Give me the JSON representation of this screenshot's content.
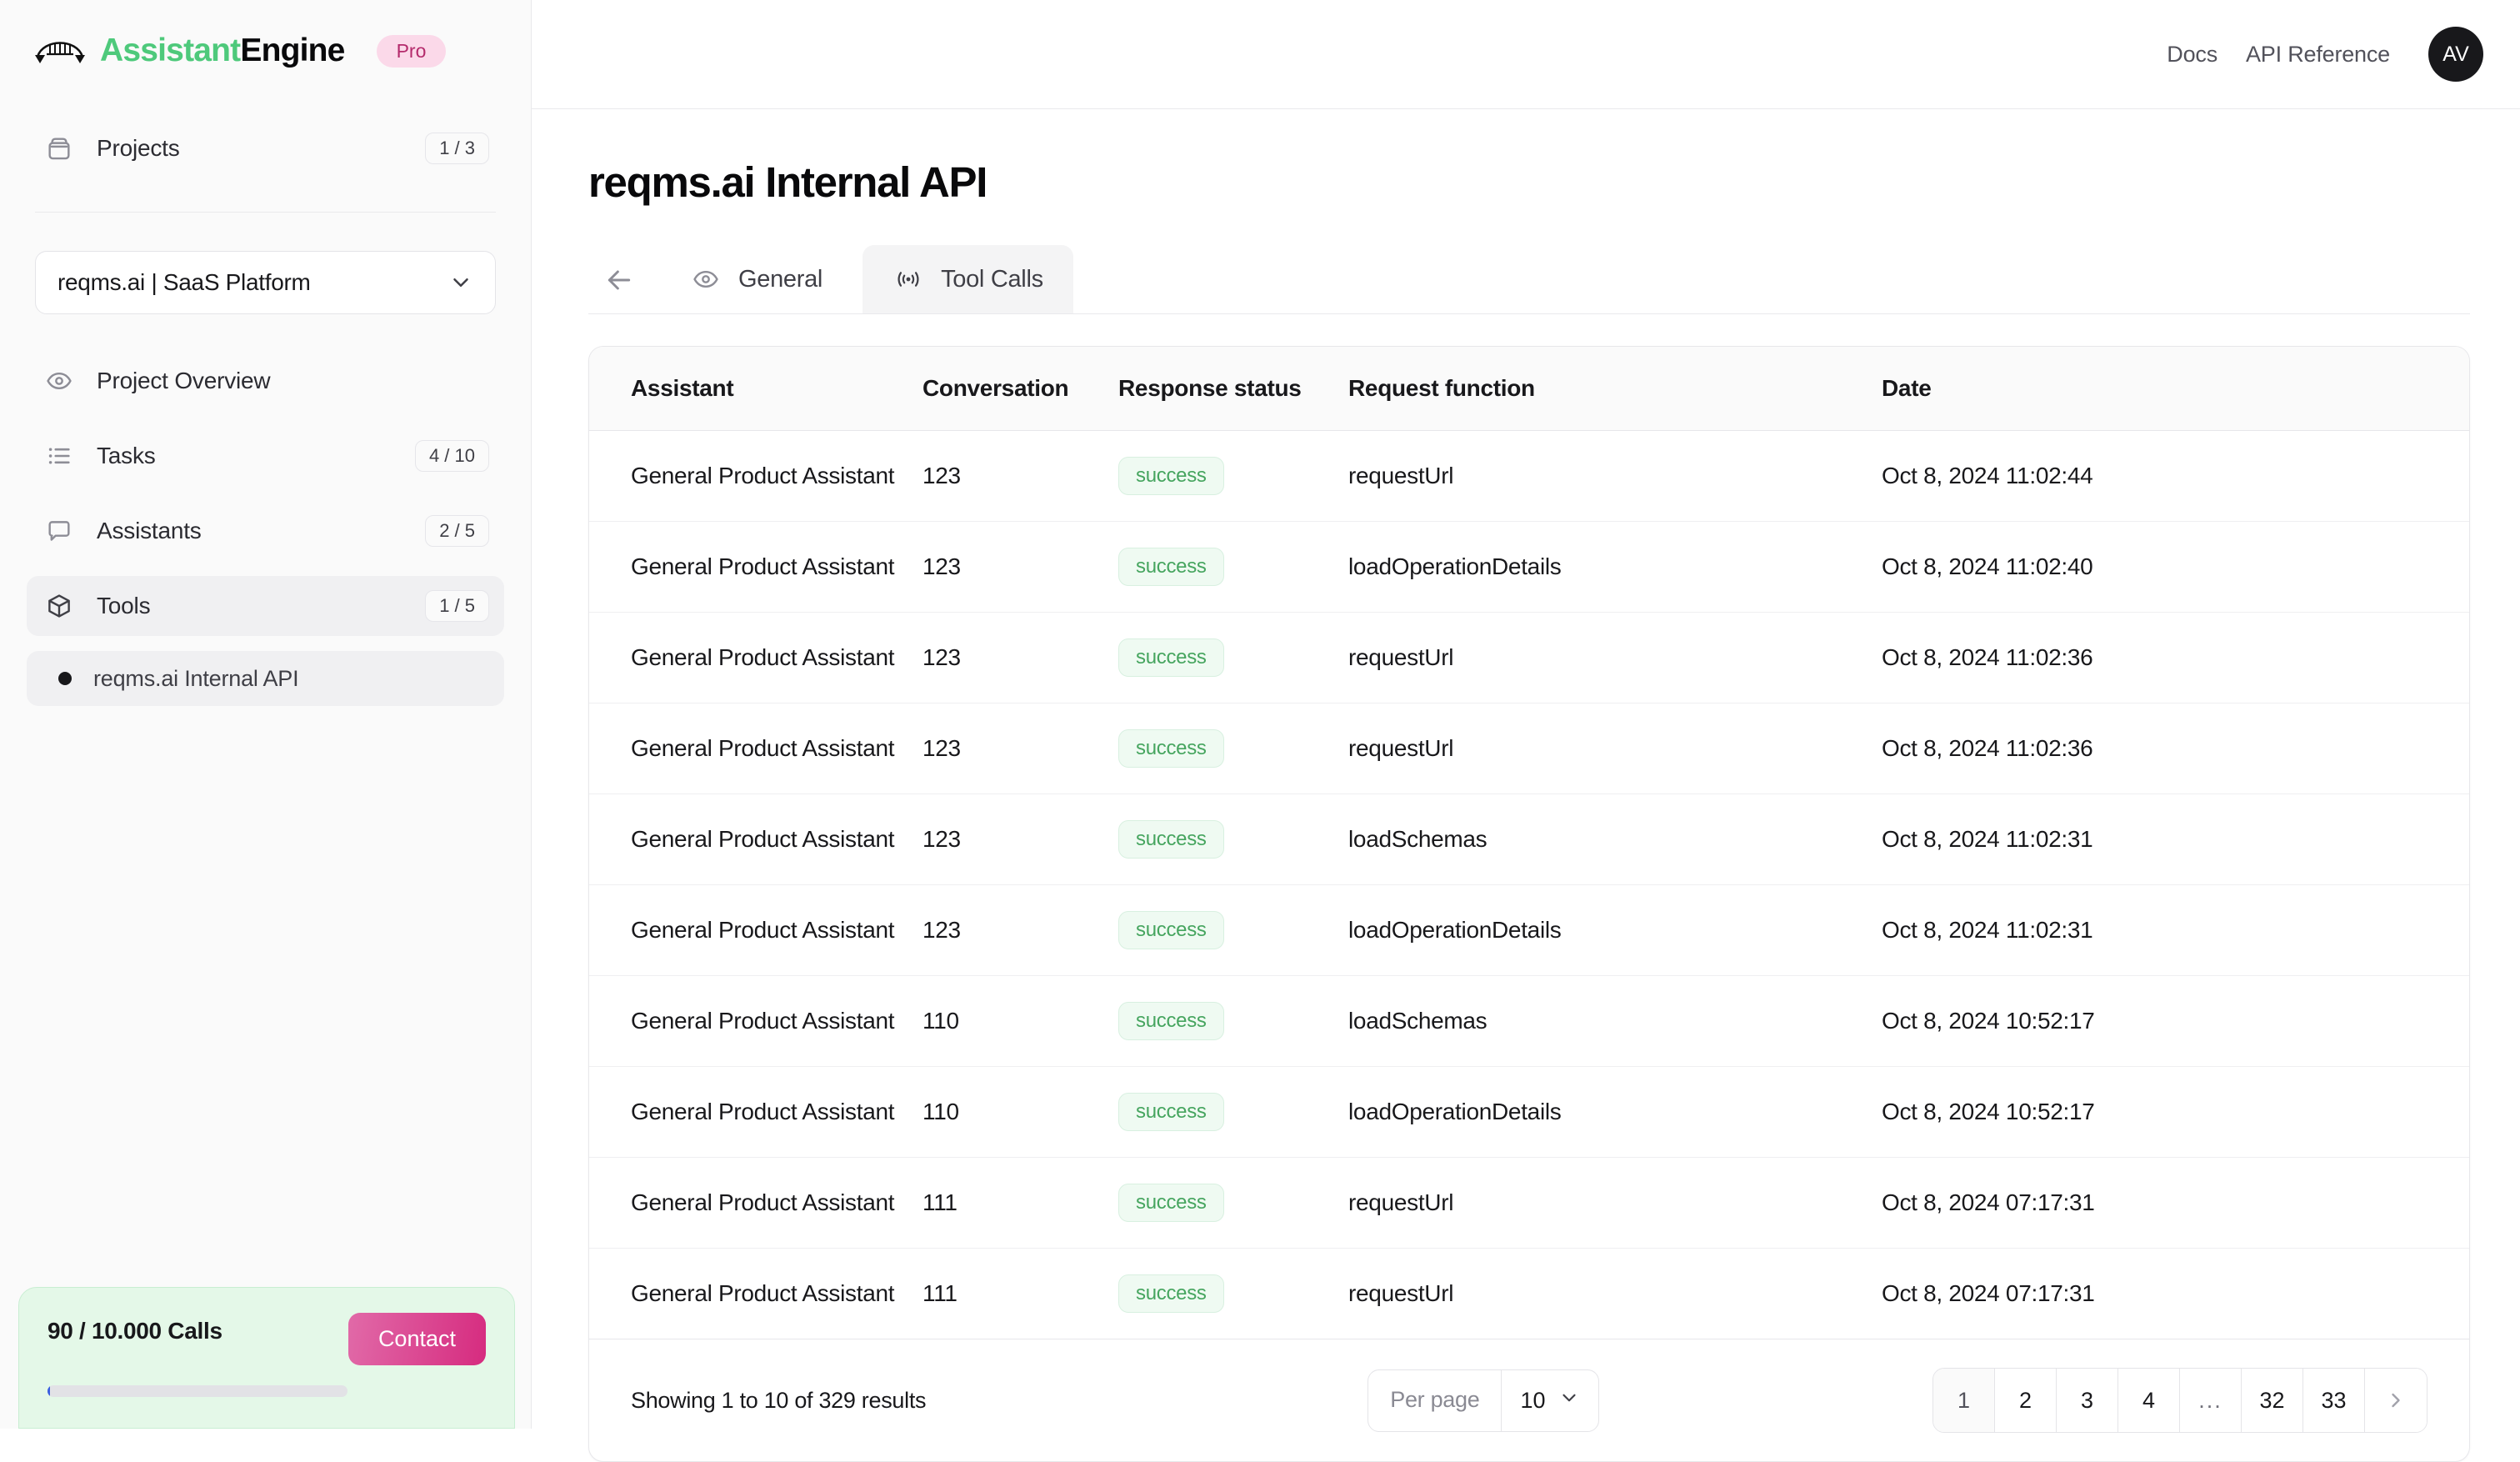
{
  "brand": {
    "name_first": "Assistant",
    "name_second": "Engine",
    "plan_badge": "Pro",
    "logo_icon": "bridge-arch-icon"
  },
  "sidebar": {
    "projects": {
      "label": "Projects",
      "count": "1 / 3",
      "icon": "archive-box-icon"
    },
    "project_selector": {
      "value": "reqms.ai | SaaS Platform",
      "icon": "chevron-down-icon"
    },
    "items": [
      {
        "label": "Project Overview",
        "count": "",
        "icon": "eye-icon"
      },
      {
        "label": "Tasks",
        "count": "4 / 10",
        "icon": "list-icon"
      },
      {
        "label": "Assistants",
        "count": "2 / 5",
        "icon": "chat-bubble-icon"
      },
      {
        "label": "Tools",
        "count": "1 / 5",
        "icon": "cube-icon"
      }
    ],
    "sub_item": {
      "label": "reqms.ai Internal API",
      "icon": "dot-icon"
    },
    "usage": {
      "text": "90 / 10.000 Calls",
      "contact_label": "Contact",
      "progress_percent": 0.9,
      "bar_color": "#3b5fe0",
      "card_bg": "#e4f8e8"
    }
  },
  "topbar": {
    "links": [
      {
        "label": "Docs"
      },
      {
        "label": "API Reference"
      }
    ],
    "avatar_initials": "AV"
  },
  "page": {
    "title": "reqms.ai Internal API",
    "back_icon": "arrow-left-icon",
    "tabs": [
      {
        "label": "General",
        "icon": "eye-icon",
        "active": false
      },
      {
        "label": "Tool Calls",
        "icon": "broadcast-signal-icon",
        "active": true
      }
    ]
  },
  "table": {
    "columns": [
      "Assistant",
      "Conversation",
      "Response status",
      "Request function",
      "Date"
    ],
    "rows": [
      {
        "assistant": "General Product Assistant",
        "conversation": "123",
        "status": "success",
        "function": "requestUrl",
        "date": "Oct 8, 2024 11:02:44"
      },
      {
        "assistant": "General Product Assistant",
        "conversation": "123",
        "status": "success",
        "function": "loadOperationDetails",
        "date": "Oct 8, 2024 11:02:40"
      },
      {
        "assistant": "General Product Assistant",
        "conversation": "123",
        "status": "success",
        "function": "requestUrl",
        "date": "Oct 8, 2024 11:02:36"
      },
      {
        "assistant": "General Product Assistant",
        "conversation": "123",
        "status": "success",
        "function": "requestUrl",
        "date": "Oct 8, 2024 11:02:36"
      },
      {
        "assistant": "General Product Assistant",
        "conversation": "123",
        "status": "success",
        "function": "loadSchemas",
        "date": "Oct 8, 2024 11:02:31"
      },
      {
        "assistant": "General Product Assistant",
        "conversation": "123",
        "status": "success",
        "function": "loadOperationDetails",
        "date": "Oct 8, 2024 11:02:31"
      },
      {
        "assistant": "General Product Assistant",
        "conversation": "110",
        "status": "success",
        "function": "loadSchemas",
        "date": "Oct 8, 2024 10:52:17"
      },
      {
        "assistant": "General Product Assistant",
        "conversation": "110",
        "status": "success",
        "function": "loadOperationDetails",
        "date": "Oct 8, 2024 10:52:17"
      },
      {
        "assistant": "General Product Assistant",
        "conversation": "111",
        "status": "success",
        "function": "requestUrl",
        "date": "Oct 8, 2024 07:17:31"
      },
      {
        "assistant": "General Product Assistant",
        "conversation": "111",
        "status": "success",
        "function": "requestUrl",
        "date": "Oct 8, 2024 07:17:31"
      }
    ],
    "status_colors": {
      "success_bg": "#effaf2",
      "success_text": "#46a55f"
    }
  },
  "pagination": {
    "showing_text": "Showing 1 to 10 of 329 results",
    "per_page_label": "Per page",
    "per_page_value": "10",
    "per_page_icon": "chevron-down-icon",
    "pages": [
      "1",
      "2",
      "3",
      "4",
      "...",
      "32",
      "33"
    ],
    "active_page": "1",
    "next_icon": "chevron-right-icon"
  }
}
